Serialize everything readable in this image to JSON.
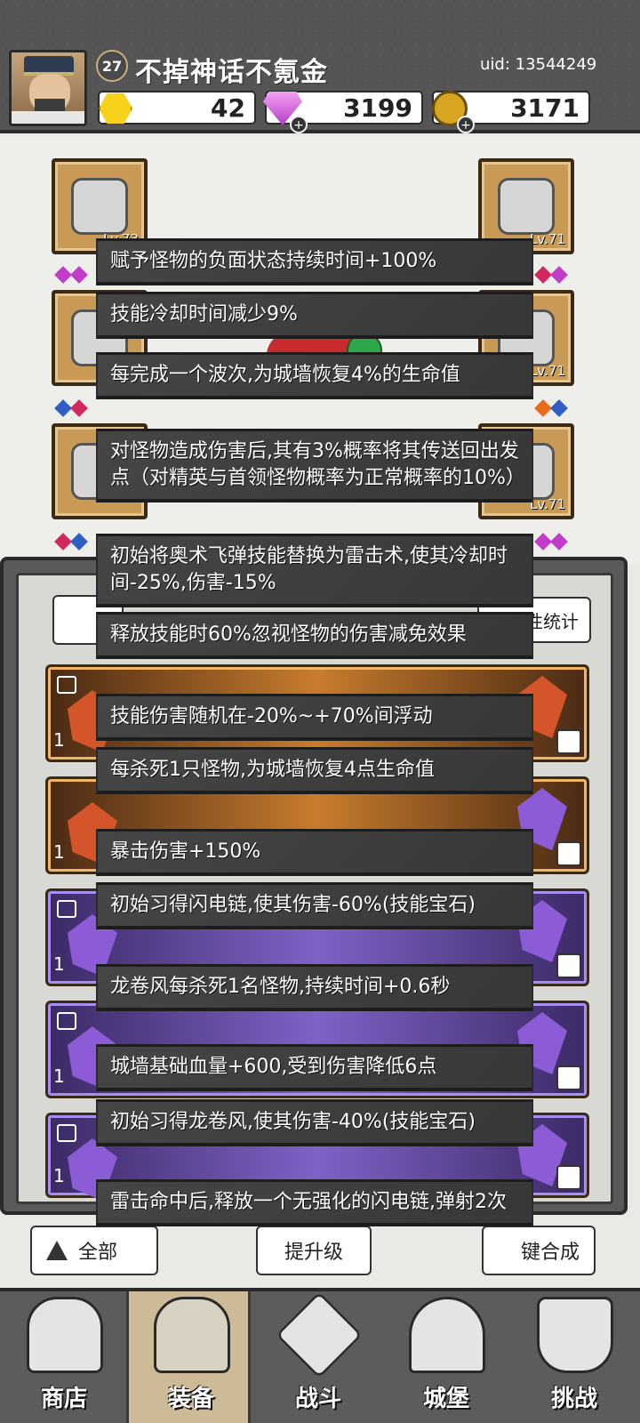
{
  "header": {
    "level": "27",
    "player_name": "不掉神话不氪金",
    "uid": "uid: 13544249",
    "resources": {
      "gold": "42",
      "gems": "3199",
      "coins": "3171"
    }
  },
  "equipment": {
    "slot_levels": {
      "top_left": "Lv.73",
      "top_right": "Lv.71",
      "mid_right": "Lv.71",
      "bottom_right": "Lv.71"
    }
  },
  "panel": {
    "stat_button": "属性统计",
    "all_button": "全部",
    "upgrade_button": "提升级",
    "compose_button": "键合成",
    "quantities": [
      "1",
      "1",
      "1",
      "1",
      "1"
    ]
  },
  "tooltips": [
    "赋予怪物的负面状态持续时间+100%",
    "技能冷却时间减少9%",
    "每完成一个波次,为城墙恢复4%的生命值",
    "对怪物造成伤害后,其有3%概率将其传送回出发点（对精英与首领怪物概率为正常概率的10%）",
    "初始将奥术飞弹技能替换为雷击术,使其冷却时间-25%,伤害-15%",
    "释放技能时60%忽视怪物的伤害减免效果",
    "技能伤害随机在-20%~+70%间浮动",
    "每杀死1只怪物,为城墙恢复4点生命值",
    "暴击伤害+150%",
    "初始习得闪电链,使其伤害-60%(技能宝石)",
    "龙卷风每杀死1名怪物,持续时间+0.6秒",
    "城墙基础血量+600,受到伤害降低6点",
    "初始习得龙卷风,使其伤害-40%(技能宝石)",
    "雷击命中后,释放一个无强化的闪电链,弹射2次"
  ],
  "nav": {
    "shop": "商店",
    "equipment": "装备",
    "battle": "战斗",
    "castle": "城堡",
    "challenge": "挑战"
  },
  "icons": {
    "gold": "hexagon-gold-icon",
    "gems": "purple-diamond-icon",
    "coins": "gold-coin-icon"
  },
  "colors": {
    "header_bg": "#555555",
    "tooltip_bg": "#3c3c3c",
    "orange_rarity": "#c87c2d",
    "purple_rarity": "#7f62c7"
  }
}
